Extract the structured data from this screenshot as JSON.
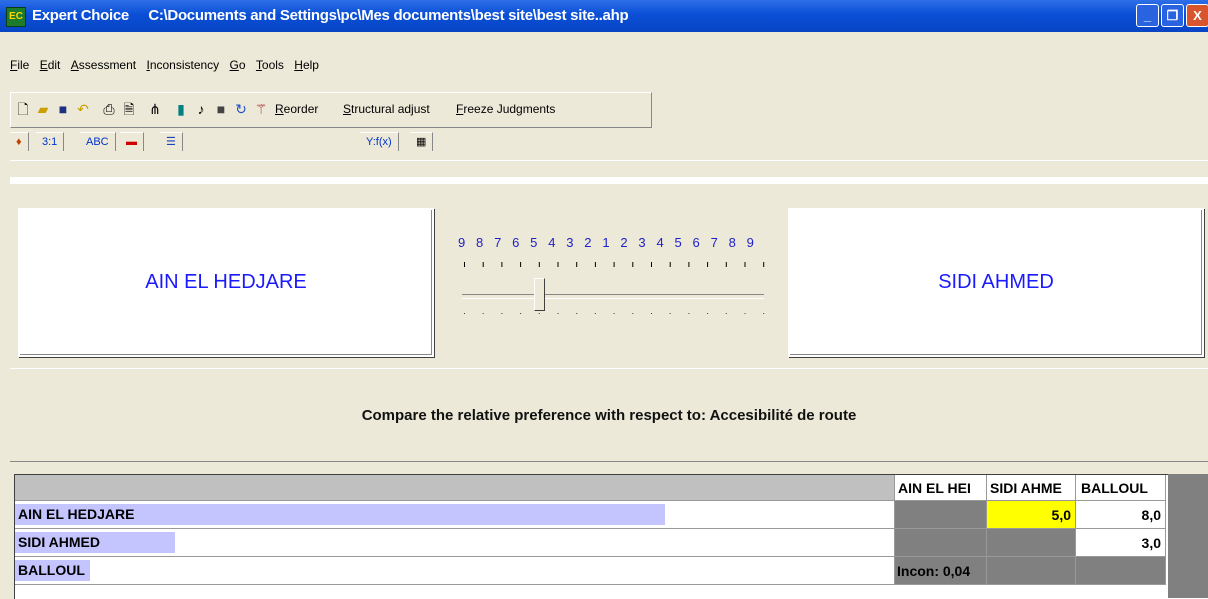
{
  "window": {
    "app_name": "Expert Choice",
    "file_path": "C:\\Documents and Settings\\pc\\Mes documents\\best site\\best site..ahp",
    "app_icon_text": "EC"
  },
  "window_controls": {
    "minimize": "_",
    "maximize": "❐",
    "close": "X"
  },
  "menu": [
    "File",
    "Edit",
    "Assessment",
    "Inconsistency",
    "Go",
    "Tools",
    "Help"
  ],
  "toolbar": {
    "icons": [
      "new-file-icon",
      "open-folder-icon",
      "save-icon",
      "undo-icon",
      "print-icon",
      "print-preview-icon",
      "hierarchy-icon",
      "calculator-icon",
      "music-note-icon",
      "stop-icon",
      "refresh-icon",
      "magic-wand-icon"
    ],
    "reorder": "Reorder",
    "structural_adjust": "Structural adjust",
    "freeze_judgments": "Freeze Judgments"
  },
  "tabs": {
    "paint_icon": "paint-icon",
    "ratio": "3:1",
    "verbal": "ABC",
    "graphic": "graphic-bars-icon",
    "bars": "bars-icon",
    "formula": "Y:f(x)",
    "matrix": "grid-icon"
  },
  "comparison": {
    "left_element": "AIN EL HEDJARE",
    "right_element": "SIDI AHMED",
    "scale_label": "9 8 7 6 5 4 3 2 1 2 3 4 5 6 7 8 9",
    "slider_value": 5,
    "slider_direction": "left"
  },
  "prompt": "Compare the relative preference  with respect to: Accesibilité de route",
  "matrix": {
    "columns": [
      "AIN EL HEI",
      "SIDI AHME",
      "BALLOUL"
    ],
    "rows": [
      {
        "label": "AIN EL HEDJARE",
        "bar": 0.85,
        "cells": [
          "",
          "5,0",
          "8,0"
        ]
      },
      {
        "label": "SIDI AHMED",
        "bar": 0.205,
        "cells": [
          "",
          "",
          "3,0"
        ]
      },
      {
        "label": "BALLOUL",
        "bar": 0.095,
        "cells": [
          "Incon: 0,04",
          "",
          ""
        ]
      }
    ],
    "highlight_color": "#ffff00",
    "bar_color": "#c4c4ff"
  }
}
